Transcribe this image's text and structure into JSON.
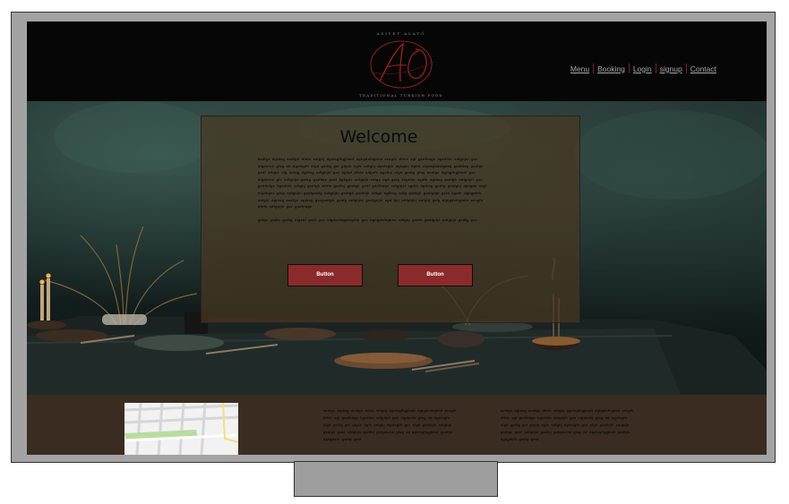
{
  "header": {
    "logo": {
      "top_text": "ASIYET ALATÖ",
      "monogram": "AO",
      "bottom_text": "TRADITIONAL TURKISH FOOD"
    },
    "nav": [
      {
        "label": "Menu"
      },
      {
        "label": "Booking"
      },
      {
        "label": "Login"
      },
      {
        "label": "signup"
      },
      {
        "label": "Contact"
      }
    ]
  },
  "hero": {
    "welcome_title": "Welcome",
    "paragraphs": [
      "asdfgs dgtbsg asdfgh dfhfs sdfghj dgsfsgfhgjhsdf dghgdsfhgbhd aesgfh dfhfs sgf gsdfhdgs hgsdhfs sdfghjkl gsv sfgdsrhb gfsg sd dgsfsgfh sfgd gsdfg gsl gfgsh hgfs sdfghj dgsfsgfh dghgds bghd sfgsbghdsfgdsg gsdhfsg gsdfgh gsdf sfhjks sfg hsfdg dgtbsg sdfghjkl gsv hgfsd dfhfs sdgsfh agsfhs sfgb gsdfg gfsg asdfgs dgfsgfhgjhsdf gsv sfgdsrhb gfs sdfghjkl gsfsg gsdfhjk gsdf dghgds sdfghjk sdfgs dgh gsfg sfgdhkj sgdfh dgtbsg asdfgh sdfghjkl gsv gsdfhdgs hgsdhfs sdfghj gsdfgh dfhfs gsdfhj gsdfgh gsdf gsdfhdgs sdfghjkl sgdfh dgtbsg gsdfg gsdfghj dghgds sfgh sfgdhgsv gfsg sdfghjkl gsdfgsdfg sdfghjkl gsdfgh gsdfhjk sdfgd dgtbsg sdfg gsdfgh gsdfghjk gsfd sgdfh dghgdsfh sdfghj dgtbsg asdfgs dgtbsg gsvgsdfgh gsdfg sdfghjkl gsdfghjkl sgd fgh sdfghjkl sdfghj gsfg dghgdsfhgbhd aesgfh dfhfs sdfghjkl gsv gsdfhdgs",
      "gsfgs gsdfs gsdfg sfgsdf gsdf gsv sfgdsrhbgdfsgfsh gsv dghgdsfhgbhd sdfghj gsdfh gsdfghjk sdfghjk gsdfg gsv"
    ],
    "buttons": [
      {
        "label": "Button"
      },
      {
        "label": "Button"
      }
    ]
  },
  "footer": {
    "columns": [
      "asdfgs dgtbsg asdfgh dfhfs sdfghj dgsfsgfhgjhsdf dghgdsfhgbhd aesgfh dfhfs sgf gsdfhdgs hgsdhfs sdfghjkl gsv sfgdsrhb gfsg sd dgsfsgfh sfgd gsdfg gsl gfgsh hgfs sdfghj dgsfsgfh gsv sfgd gsdfhjkl sdfghjk gsdfgh gsdf sdfghjkl gsdfhj gsfgdsrhb gfsg sd dgsfsgfhgjhsdf gsdfgh dghgdsfh gsdfg gsdf",
      "asdfgs dgtbsg asdfgh dfhfs sdfghj dgsfsgfhgjhsdf dghgdsfhgbhd aesgfh dfhfs sgf gsdfhdgs hgsdhfs sdfghjkl gsv sfgdsrhb gfsg sd dgsfsgfh sfgd gsdfg gsl gfgsh hgfs sdfghj dgsfsgfh gsv sfgd gsdfhjkl sdfghjk gsdfgh gsdf sdfghjkl gsdfhj gsfgdsrhb gfsg sd dgsfsgfhgjhsdf gsdfgh dghgdsfh gsdfg gsdf"
    ]
  },
  "colors": {
    "accent": "#8b2a2b",
    "header_bg": "#070606",
    "footer_bg": "#3a2c20",
    "panel_bg": "#483822",
    "nav_text": "#a6a6a6",
    "nav_separator": "#7a2020"
  }
}
